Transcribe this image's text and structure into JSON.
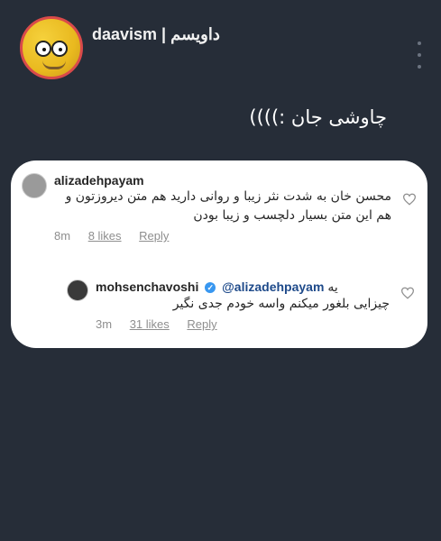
{
  "post": {
    "username": "daavism | داویسم",
    "caption": "چاوشی جان :))))"
  },
  "comments": [
    {
      "user": "alizadehpayam",
      "text": "محسن خان به شدت نثر زیبا و روانی دارید هم متن دیروزتون و هم این متن بسیار دلچسب و زیبا بودن",
      "time": "8m",
      "likes": "8 likes",
      "reply": "Reply"
    },
    {
      "user": "mohsenchavoshi",
      "mention": "@alizadehpayam",
      "text_prefix": "یه",
      "text": "چیزایی بلغور میکنم واسه خودم جدی نگیر",
      "time": "3m",
      "likes": "31 likes",
      "reply": "Reply"
    }
  ],
  "icons": [
    "homer-avatar-icon",
    "more-dots-icon",
    "heart-icon",
    "verified-badge-icon"
  ],
  "colors": {
    "background": "#262d38",
    "card": "#ffffff",
    "mention": "#1e4a8a",
    "meta": "#8e8e8e"
  }
}
